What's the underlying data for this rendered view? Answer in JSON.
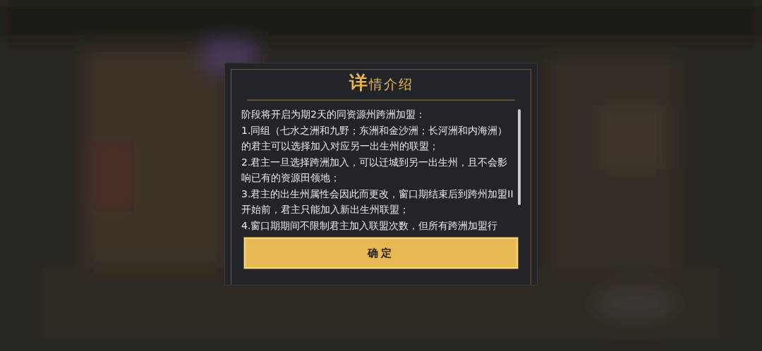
{
  "dialog": {
    "title_first": "详",
    "title_rest": "情介绍",
    "paragraphs": [
      "阶段将开启为期2天的同资源州跨洲加盟：",
      "1.同组（七水之洲和九野；东洲和金沙洲；长河洲和内海洲）的君主可以选择加入对应另一出生州的联盟；",
      "2.君主一旦选择跨洲加入，可以迁城到另一出生州，且不会影响已有的资源田领地；",
      "3.君主的出生州属性会因此而更改，窗口期结束后到跨州加盟II 开始前，君主只能加入新出生州联盟；",
      "4.窗口期期间不限制君主加入联盟次数，但所有跨洲加盟行"
    ],
    "confirm_button": "确定"
  }
}
